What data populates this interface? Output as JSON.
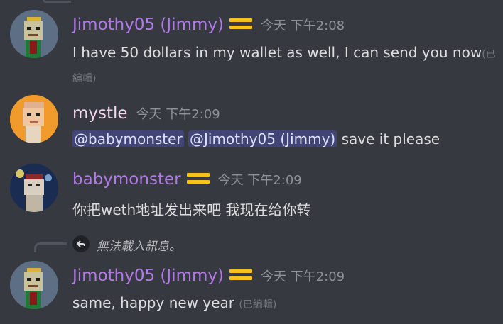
{
  "messages": [
    {
      "username": "Jimothy05 (Jimmy)",
      "timestamp": "今天 下午2:08",
      "text": "I have 50 dollars in my wallet as well, I can send you now",
      "edited_a": "(已",
      "edited_b": "編輯)"
    },
    {
      "username": "mystle",
      "timestamp": "今天 下午2:09",
      "mention1": "@babymonster",
      "mention2": "@Jimothy05 (Jimmy)",
      "text": " save it please"
    },
    {
      "username": "babymonster",
      "timestamp": "今天 下午2:09",
      "text": "你把weth地址发出来吧 我现在给你转"
    },
    {
      "reply_notice": "無法載入訊息。",
      "username": "Jimothy05 (Jimmy)",
      "timestamp": "今天 下午2:09",
      "text": "same, happy new year ",
      "edited": "(已編輯)"
    }
  ],
  "colors": {
    "background": "#36393f",
    "username_purple": "#b27ae8",
    "username_pink": "#f5d6ef",
    "badge": "#f7c31b",
    "mention_bg": "#4f5599"
  },
  "icons": [
    "avatar-pixel-punk",
    "badge-icon",
    "reply-arrow-icon"
  ]
}
